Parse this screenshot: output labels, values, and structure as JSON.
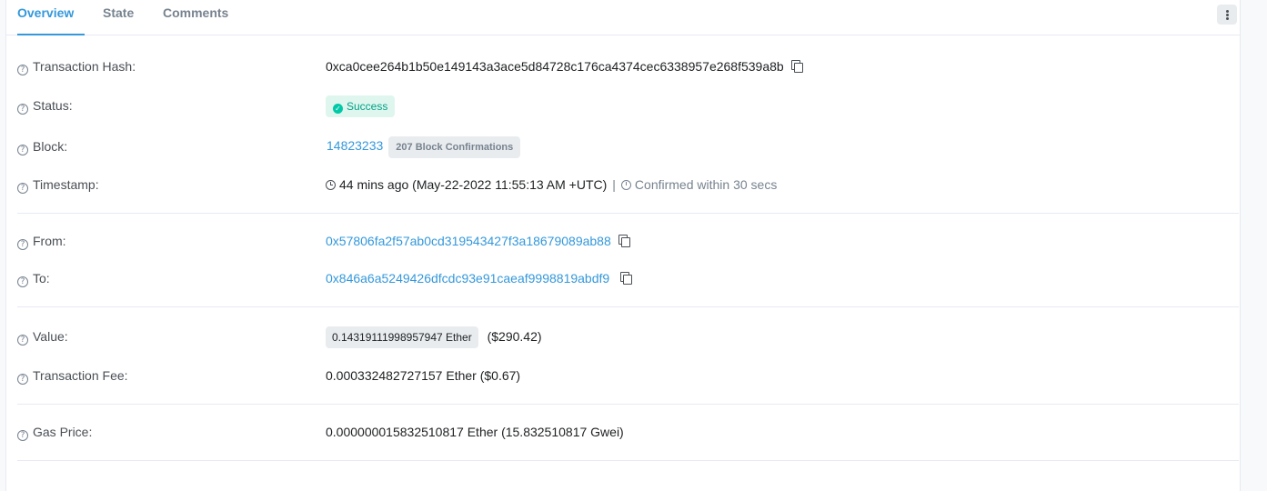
{
  "tabs": [
    {
      "label": "Overview",
      "active": true
    },
    {
      "label": "State",
      "active": false
    },
    {
      "label": "Comments",
      "active": false
    }
  ],
  "more_icon": "vertical-dots-icon",
  "fields": {
    "tx_hash": {
      "label": "Transaction Hash:",
      "value": "0xca0cee264b1b50e149143a3ace5d84728c176ca4374cec6338957e268f539a8b"
    },
    "status": {
      "label": "Status:",
      "value": "Success"
    },
    "block": {
      "label": "Block:",
      "value": "14823233",
      "confirmations": "207 Block Confirmations"
    },
    "timestamp": {
      "label": "Timestamp:",
      "value": "44 mins ago (May-22-2022 11:55:13 AM +UTC)",
      "separator": "|",
      "confirmed": "Confirmed within 30 secs"
    },
    "from": {
      "label": "From:",
      "value": "0x57806fa2f57ab0cd319543427f3a18679089ab88"
    },
    "to": {
      "label": "To:",
      "value": "0x846a6a5249426dfcdc93e91caeaf9998819abdf9"
    },
    "value": {
      "label": "Value:",
      "amount": "0.14319111998957947 Ether",
      "usd": "($290.42)"
    },
    "tx_fee": {
      "label": "Transaction Fee:",
      "value": "0.000332482727157 Ether ($0.67)"
    },
    "gas_price": {
      "label": "Gas Price:",
      "value": "0.000000015832510817 Ether (15.832510817 Gwei)"
    }
  },
  "colors": {
    "accent": "#3498db",
    "success_bg": "#dff6ee",
    "success_text": "#00a186",
    "badge_bg": "#e9ecef"
  }
}
